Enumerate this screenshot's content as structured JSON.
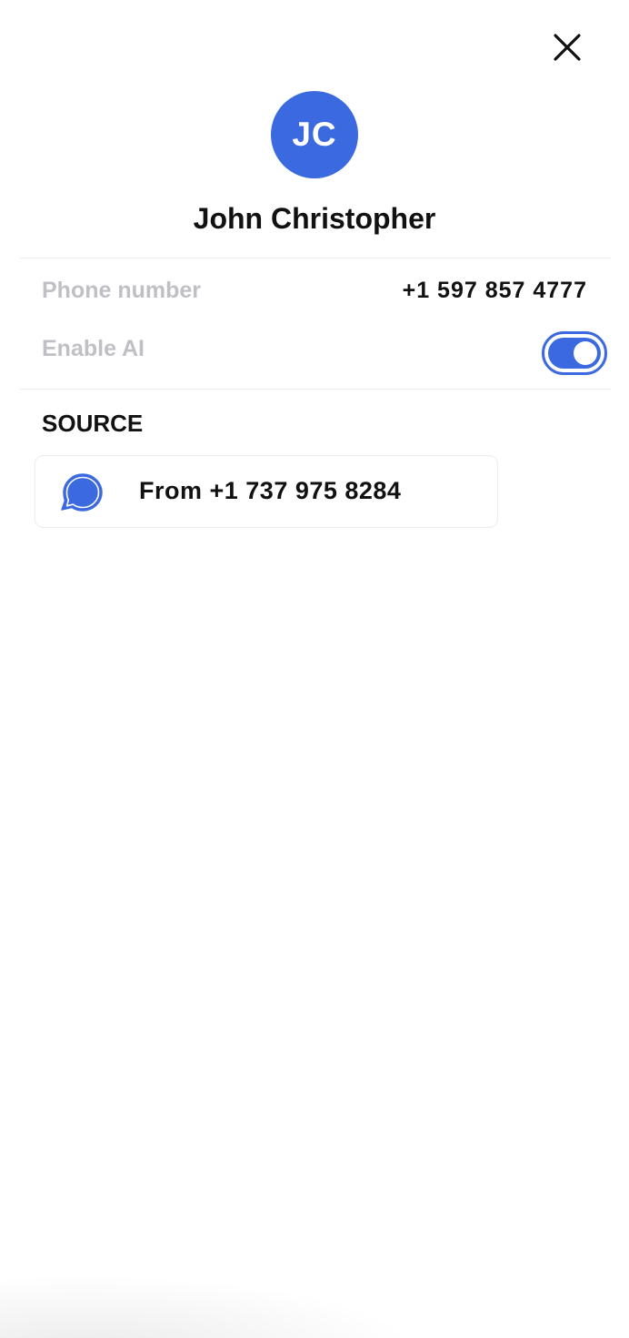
{
  "contact": {
    "initials": "JC",
    "name": "John Christopher",
    "avatar_color": "#3a69e0"
  },
  "details": {
    "phone_label": "Phone number",
    "phone_value": "+1 597 857 4777",
    "ai_label": "Enable AI",
    "ai_enabled": true
  },
  "source": {
    "section_title": "SOURCE",
    "item_text": "From +1 737 975 8284",
    "item_icon": "chat-bubble-icon"
  },
  "icons": {
    "close": "close-icon"
  },
  "colors": {
    "accent": "#3a69e0",
    "label_gray": "#c0bfc6",
    "divider": "#ececee"
  }
}
